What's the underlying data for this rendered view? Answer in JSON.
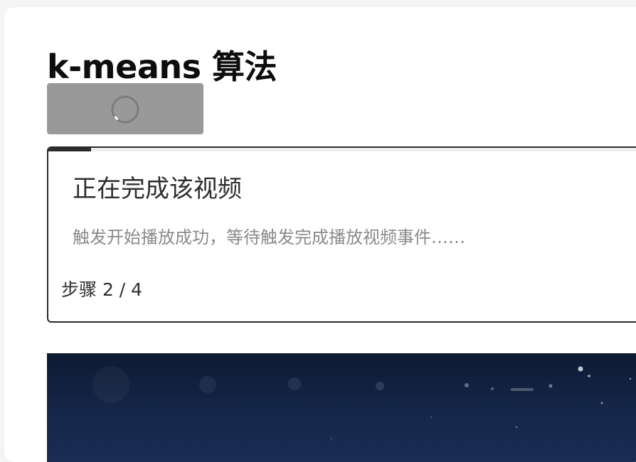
{
  "page": {
    "title": "k-means 算法"
  },
  "action_button": {
    "state": "loading",
    "icon": "spinner-icon"
  },
  "step_panel": {
    "progress": 0.07,
    "title": "正在完成该视频",
    "description": "触发开始播放成功，等待触发完成播放视频事件……",
    "counter": "步骤 2 / 4"
  },
  "video": {
    "background_color": "#142648"
  },
  "colors": {
    "button_gray": "#999999",
    "panel_border": "#2b2b2b",
    "muted_text": "#8a8a8a"
  }
}
